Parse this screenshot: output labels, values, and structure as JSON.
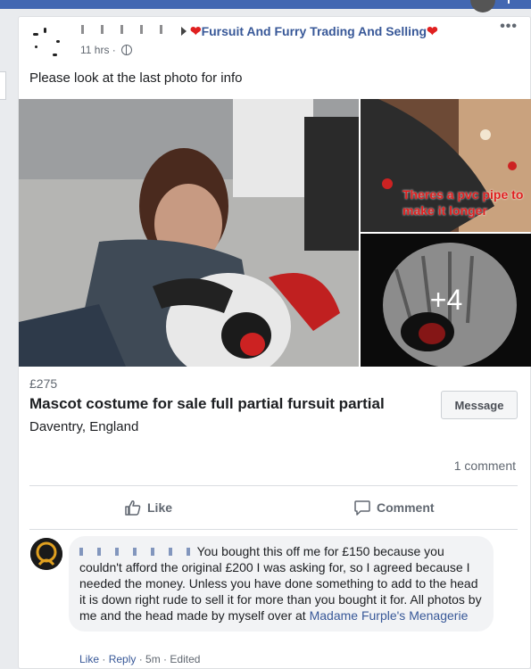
{
  "post": {
    "group_name": "Fursuit And Furry Trading And Selling",
    "time": "11 hrs",
    "more": "•••",
    "text": "Please look at the last photo for info",
    "photo_overlay_text": "Theres a pvc pipe to make it longer",
    "more_photos": "+4",
    "price": "£275",
    "title": "Mascot costume for sale full partial fursuit partial",
    "location": "Daventry, England",
    "message_button": "Message",
    "comment_count": "1 comment",
    "actions": {
      "like": "Like",
      "comment": "Comment"
    }
  },
  "comment": {
    "text": "You bought this off me for £150 because you couldn't afford the original £200 I was asking for, so I agreed because I needed the money. Unless you have done something to add to the head it is down right rude to sell it for more than you bought it for. All photos by me and the head made by myself over at",
    "link": "Madame Furple's Menagerie",
    "like": "Like",
    "reply": "Reply",
    "time": "5m",
    "edited": "Edited"
  },
  "colors": {
    "accent": "#385898",
    "topbar": "#4267b2",
    "heart": "#e02020"
  }
}
